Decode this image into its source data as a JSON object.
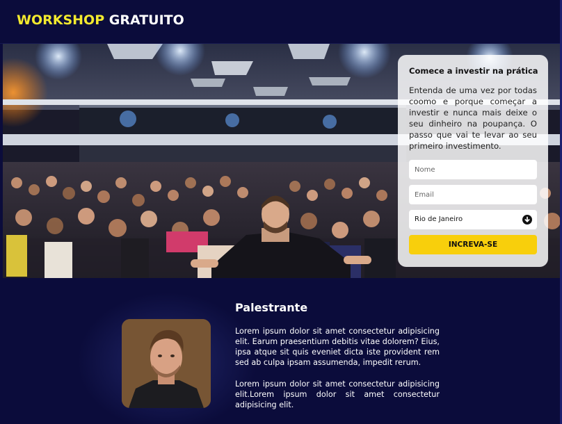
{
  "header": {
    "brand_word1": "WORKSHOP",
    "brand_word2": "GRATUITO"
  },
  "hero": {
    "image_description_icon": "event-audience-photo"
  },
  "form": {
    "title": "Comece a investir na prática",
    "description": "Entenda de uma vez por todas coomo e porque começar a investir e nunca mais deixe o seu dinheiro na poupança. O passo que vai te levar ao seu primeiro investimento.",
    "name_placeholder": "Nome",
    "email_placeholder": "Email",
    "city_selected": "Rio de Janeiro",
    "submit_label": "INCREVA-SE"
  },
  "speaker": {
    "title": "Palestrante",
    "paragraph1": "Lorem ipsum dolor sit amet consectetur adipisicing elit. Earum praesentium debitis vitae dolorem? Eius, ipsa atque sit quis eveniet dicta iste provident rem sed ab culpa ipsam assumenda, impedit rerum.",
    "paragraph2": "Lorem ipsum dolor sit amet consectetur adipisicing elit.Lorem ipsum dolor sit amet consectetur adipisicing elit."
  },
  "colors": {
    "background": "#0b0c3b",
    "brand_accent": "#f3ea2e",
    "cta": "#f8cf0c"
  }
}
